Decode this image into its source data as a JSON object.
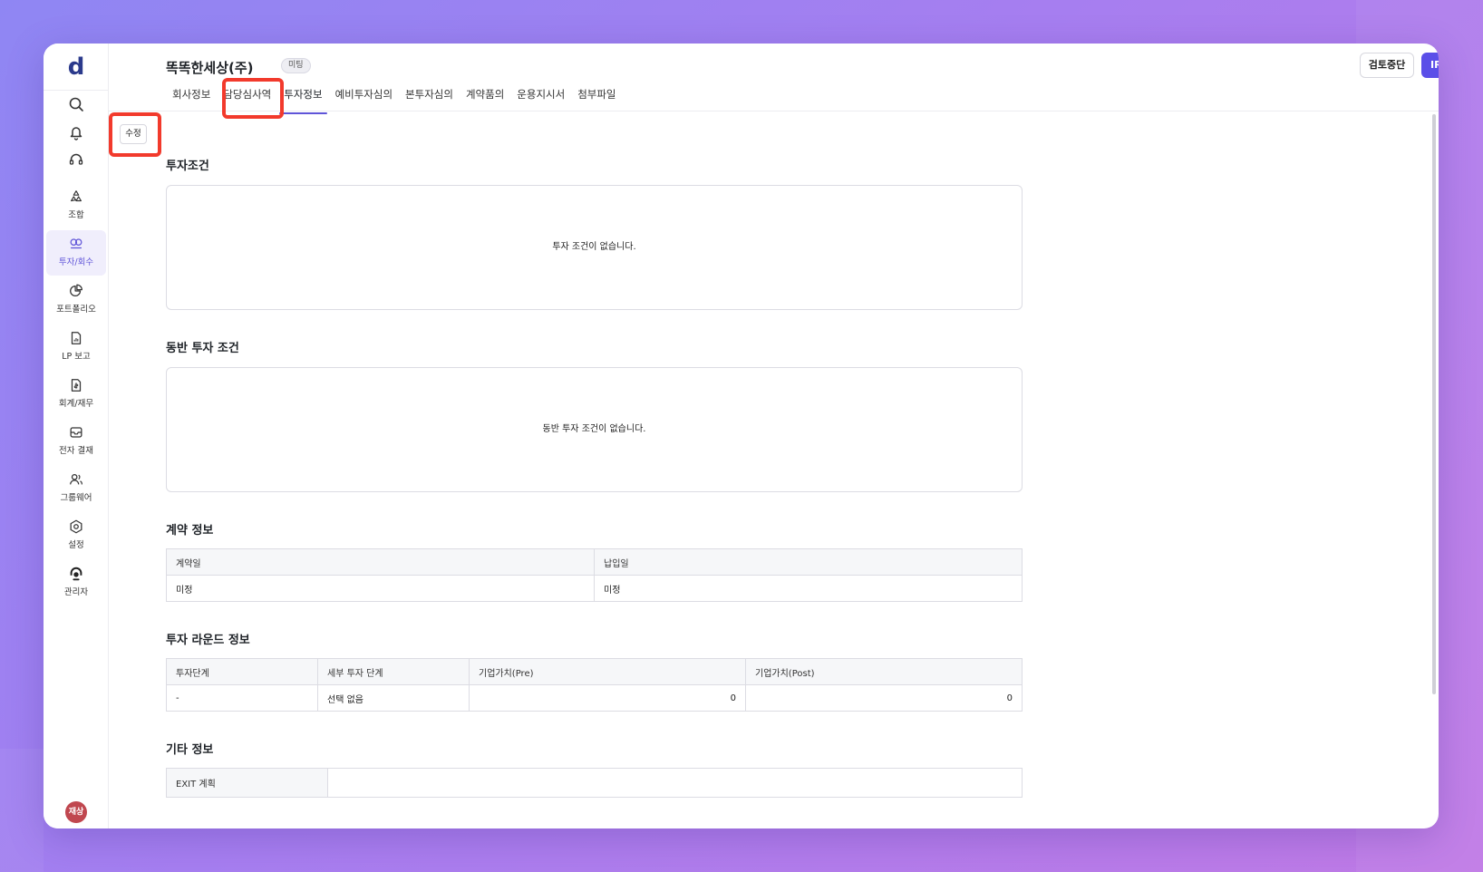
{
  "app": {
    "logo": "d",
    "title": "똑똑한세상(주)",
    "status_badge": "미팅"
  },
  "header": {
    "stop_review_label": "검토중단",
    "ir_label": "IR"
  },
  "tabs": [
    {
      "label": "회사정보"
    },
    {
      "label": "담당심사역"
    },
    {
      "label": "투자정보",
      "active": true
    },
    {
      "label": "예비투자심의"
    },
    {
      "label": "본투자심의"
    },
    {
      "label": "계약품의"
    },
    {
      "label": "운용지시서"
    },
    {
      "label": "첨부파일"
    }
  ],
  "sidebar": {
    "items": [
      {
        "label": "조합",
        "icon": "recycle-icon"
      },
      {
        "label": "투자/회수",
        "icon": "investment-icon",
        "active": true
      },
      {
        "label": "포트폴리오",
        "icon": "pie-chart-icon"
      },
      {
        "label": "LP 보고",
        "icon": "report-icon"
      },
      {
        "label": "회계/재무",
        "icon": "finance-doc-icon"
      },
      {
        "label": "전자 결재",
        "icon": "inbox-icon"
      },
      {
        "label": "그룹웨어",
        "icon": "users-icon"
      },
      {
        "label": "설정",
        "icon": "gear-icon"
      },
      {
        "label": "관리자",
        "icon": "admin-icon"
      }
    ],
    "avatar": "재상"
  },
  "edit_label": "수정",
  "sections": {
    "investment_terms": {
      "title": "투자조건",
      "empty": "투자 조건이 없습니다."
    },
    "co_investment": {
      "title": "동반 투자 조건",
      "empty": "동반 투자 조건이 없습니다."
    },
    "contract": {
      "title": "계약 정보",
      "headers": [
        "계약일",
        "납입일"
      ],
      "values": [
        "미정",
        "미정"
      ]
    },
    "round": {
      "title": "투자 라운드 정보",
      "headers": [
        "투자단계",
        "세부 투자 단계",
        "기업가치(Pre)",
        "기업가치(Post)"
      ],
      "values": [
        "-",
        "선택 없음",
        "0",
        "0"
      ]
    },
    "other": {
      "title": "기타 정보",
      "exit_label": "EXIT 계획",
      "exit_value": ""
    }
  },
  "colors": {
    "accent": "#5b4fe8",
    "highlight": "#f23a2c",
    "avatar": "#c0474f"
  }
}
